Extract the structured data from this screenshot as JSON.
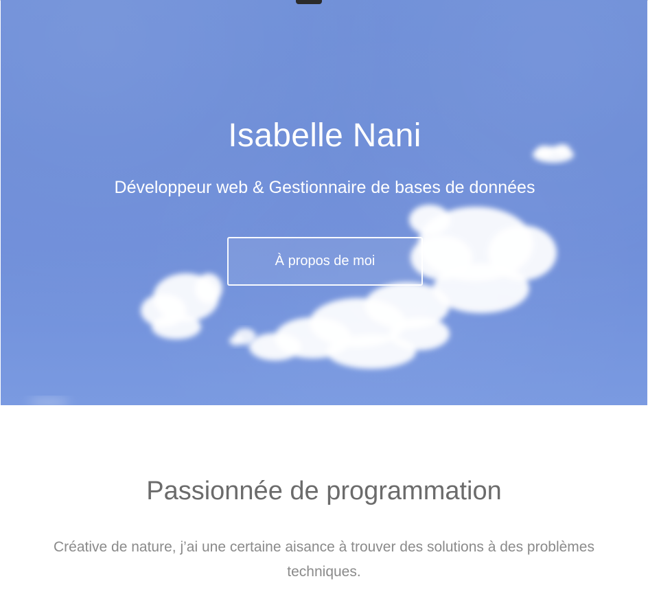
{
  "hero": {
    "title": "Isabelle Nani",
    "subtitle": "Développeur web & Gestionnaire de bases de données",
    "cta_label": "À propos de moi",
    "background_color": "#6f8fd8",
    "cloud_color": "#ffffff"
  },
  "section": {
    "title": "Passionnée de programmation",
    "body": "Créative de nature, j’ai une certaine aisance à trouver des solutions à des problèmes techniques."
  },
  "icons": {
    "top_handle": "handle-icon"
  }
}
